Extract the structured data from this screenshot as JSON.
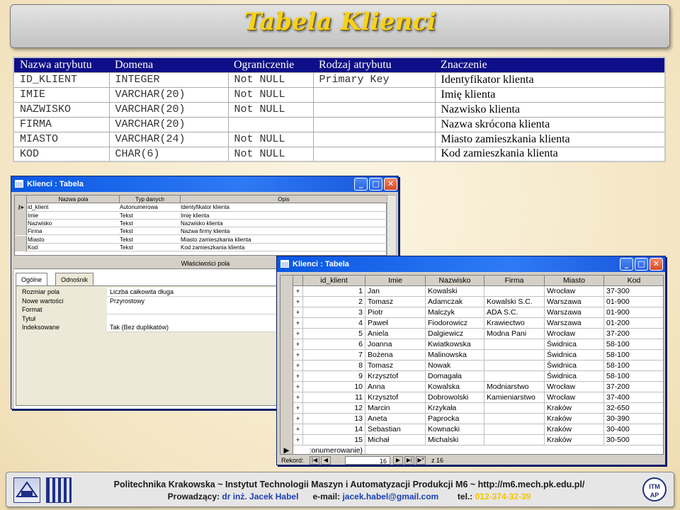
{
  "slide": {
    "title": "Tabela Klienci"
  },
  "schema": {
    "headers": [
      "Nazwa atrybutu",
      "Domena",
      "Ograniczenie",
      "Rodzaj atrybutu",
      "Znaczenie"
    ],
    "rows": [
      {
        "attr": "ID_KLIENT",
        "domain": "INTEGER",
        "constraint": "Not NULL",
        "kind": "Primary Key",
        "meaning": "Identyfikator klienta"
      },
      {
        "attr": "IMIE",
        "domain": "VARCHAR(20)",
        "constraint": "Not NULL",
        "kind": "",
        "meaning": "Imię klienta"
      },
      {
        "attr": "NAZWISKO",
        "domain": "VARCHAR(20)",
        "constraint": "Not NULL",
        "kind": "",
        "meaning": "Nazwisko klienta"
      },
      {
        "attr": "FIRMA",
        "domain": "VARCHAR(20)",
        "constraint": "",
        "kind": "",
        "meaning": "Nazwa skrócona klienta"
      },
      {
        "attr": "MIASTO",
        "domain": "VARCHAR(24)",
        "constraint": "Not NULL",
        "kind": "",
        "meaning": "Miasto zamieszkania klienta"
      },
      {
        "attr": "KOD",
        "domain": "CHAR(6)",
        "constraint": "Not NULL",
        "kind": "",
        "meaning": "Kod zamieszkania klienta"
      }
    ]
  },
  "design_window": {
    "title": "Klienci : Tabela",
    "columns": [
      "Nazwa pola",
      "Typ danych",
      "Opis"
    ],
    "fields": [
      {
        "name": "id_klient",
        "type": "Autonumerowa",
        "desc": "Identyfikator klienta",
        "key": true
      },
      {
        "name": "Imie",
        "type": "Tekst",
        "desc": "Imię klienta"
      },
      {
        "name": "Nazwisko",
        "type": "Tekst",
        "desc": "Nazwisko klienta"
      },
      {
        "name": "Firma",
        "type": "Tekst",
        "desc": "Nazwa firmy klienta"
      },
      {
        "name": "Miasto",
        "type": "Tekst",
        "desc": "Miasto zamieszkania klienta"
      },
      {
        "name": "Kod",
        "type": "Tekst",
        "desc": "Kod zamieszkania klienta"
      }
    ],
    "props_label": "Właściwości pola",
    "tabs": [
      "Ogólne",
      "Odnośnik"
    ],
    "properties": [
      {
        "name": "Rozmiar pola",
        "value": "Liczba całkowita długa"
      },
      {
        "name": "Nowe wartości",
        "value": "Przyrostowy"
      },
      {
        "name": "Format",
        "value": ""
      },
      {
        "name": "Tytuł",
        "value": ""
      },
      {
        "name": "Indeksowane",
        "value": "Tak (Bez duplikatów)"
      }
    ]
  },
  "datasheet_window": {
    "title": "Klienci : Tabela",
    "columns": [
      "id_klient",
      "Imie",
      "Nazwisko",
      "Firma",
      "Miasto",
      "Kod"
    ],
    "rows": [
      [
        "1",
        "Jan",
        "Kowalski",
        "",
        "Wrocław",
        "37-300"
      ],
      [
        "2",
        "Tomasz",
        "Adamczak",
        "Kowalski S.C.",
        "Warszawa",
        "01-900"
      ],
      [
        "3",
        "Piotr",
        "Malczyk",
        "ADA S.C.",
        "Warszawa",
        "01-900"
      ],
      [
        "4",
        "Paweł",
        "Fiodorowicz",
        "Krawiectwo",
        "Warszawa",
        "01-200"
      ],
      [
        "5",
        "Aniela",
        "Dalgiewicz",
        "Modna Pani",
        "Wrocław",
        "37-200"
      ],
      [
        "6",
        "Joanna",
        "Kwiatkowska",
        "",
        "Świdnica",
        "58-100"
      ],
      [
        "7",
        "Bożena",
        "Malinowska",
        "",
        "Świdnica",
        "58-100"
      ],
      [
        "8",
        "Tomasz",
        "Nowak",
        "",
        "Świdnica",
        "58-100"
      ],
      [
        "9",
        "Krzysztof",
        "Domagała",
        "",
        "Świdnica",
        "58-100"
      ],
      [
        "10",
        "Anna",
        "Kowalska",
        "Modniarstwo",
        "Wrocław",
        "37-200"
      ],
      [
        "11",
        "Krzysztof",
        "Dobrowolski",
        "Kamieniarstwo",
        "Wrocław",
        "37-400"
      ],
      [
        "12",
        "Marcin",
        "Krzykała",
        "",
        "Kraków",
        "32-650"
      ],
      [
        "13",
        "Aneta",
        "Paprocka",
        "",
        "Kraków",
        "30-390"
      ],
      [
        "14",
        "Sebastian",
        "Kownacki",
        "",
        "Kraków",
        "30-400"
      ],
      [
        "15",
        "Michał",
        "Michalski",
        "",
        "Kraków",
        "30-500"
      ]
    ],
    "new_row": ":onumerowanie)",
    "nav": {
      "label": "Rekord:",
      "current": "16",
      "of_text": "z 16"
    }
  },
  "footer": {
    "line1": "Politechnika Krakowska   ~   Instytut Technologii Maszyn i Automatyzacji Produkcji M6   ~   http://m6.mech.pk.edu.pl/",
    "lecturer_label": "Prowadzący:",
    "lecturer": "dr inż. Jacek Habel",
    "email_label": "e-mail:",
    "email": "jacek.habel@gmail.com",
    "phone_label": "tel.:",
    "phone": "012-374-32-39",
    "logos": {
      "left1": "PK",
      "right": "ITM AP"
    }
  }
}
